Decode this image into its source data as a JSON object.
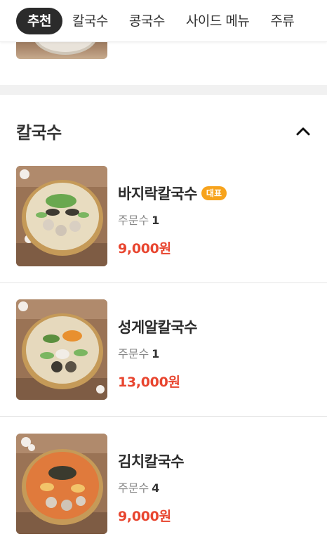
{
  "tabs": [
    {
      "label": "추천",
      "active": true
    },
    {
      "label": "칼국수",
      "active": false
    },
    {
      "label": "콩국수",
      "active": false
    },
    {
      "label": "사이드 메뉴",
      "active": false
    },
    {
      "label": "주류",
      "active": false
    }
  ],
  "section": {
    "title": "칼국수",
    "collapse_icon": "chevron-up-icon"
  },
  "order_count_label": "주문수",
  "items": [
    {
      "name": "바지락칼국수",
      "badge": "대표",
      "order_count": "1",
      "price": "9,000원"
    },
    {
      "name": "성게알칼국수",
      "badge": "",
      "order_count": "1",
      "price": "13,000원"
    },
    {
      "name": "김치칼국수",
      "badge": "",
      "order_count": "4",
      "price": "9,000원"
    }
  ],
  "colors": {
    "active_tab_bg": "#2b2b2b",
    "price": "#e8452f",
    "badge": "#f7a31c"
  }
}
